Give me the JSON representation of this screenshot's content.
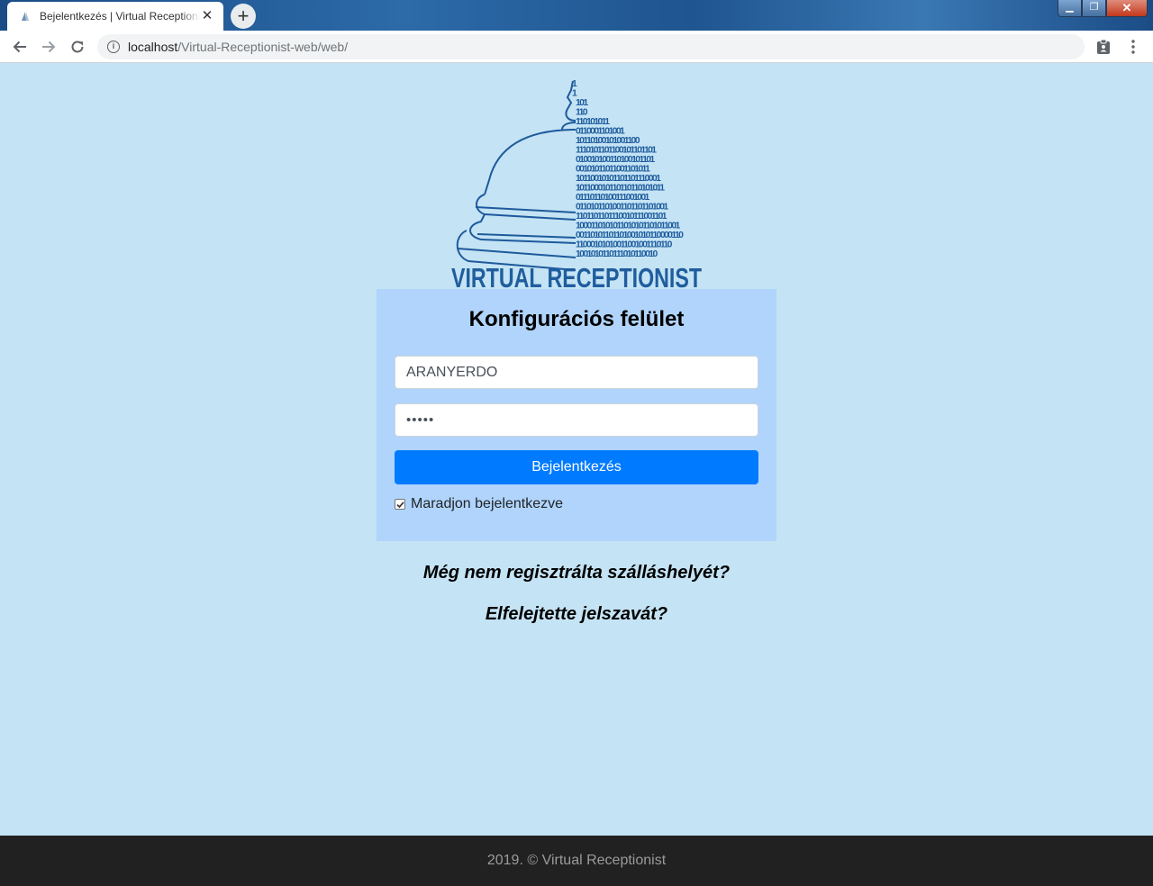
{
  "browser": {
    "tab_title": "Bejelentkezés | Virtual Receptionist",
    "tab_close": "✕",
    "new_tab": "+",
    "url_host": "localhost",
    "url_path": "/Virtual-Receptionist-web/web/",
    "window_buttons": {
      "minimize": "▁",
      "maximize": "❐",
      "close": "✕"
    }
  },
  "logo": {
    "text": "VIRTUAL RECEPTIONIST",
    "binary_lines": [
      "1",
      "1",
      "101",
      "110",
      "110101011",
      "0110001101001",
      "10110100101001100",
      "1110101101100101101101",
      "010010100110100101101",
      "00101011011001101011",
      "10110010101101101110001",
      "101100010110110110101011",
      "01110110100111001001",
      "0110101101001101101101001",
      "1101101101110010111001101",
      "1000110101011010101101011001",
      "00110101101101001010110000110",
      "11000101010011001001110110",
      "1001010110111010110010"
    ],
    "colors": {
      "primary": "#1e5a9c",
      "text": "#1f5d9e"
    }
  },
  "login": {
    "title": "Konfigurációs felület",
    "username_value": "ARANYERDO",
    "password_masked": "•••••",
    "submit_label": "Bejelentkezés",
    "remember_label": "Maradjon bejelentkezve",
    "remember_checked": true
  },
  "links": {
    "register": "Még nem regisztrálta szálláshelyét?",
    "forgot": "Elfelejtette jelszavát?"
  },
  "footer": {
    "text": "2019. © Virtual Receptionist"
  },
  "colors": {
    "page_bg": "#c4e3f4",
    "card_bg": "#b0d4fb",
    "button_bg": "#007bff",
    "footer_bg": "#212121"
  },
  "icons": [
    "back-arrow-icon",
    "forward-arrow-icon",
    "reload-icon",
    "site-info-icon",
    "clipboard-extension-icon",
    "kebab-menu-icon",
    "favicon-icon",
    "checkmark-icon"
  ]
}
